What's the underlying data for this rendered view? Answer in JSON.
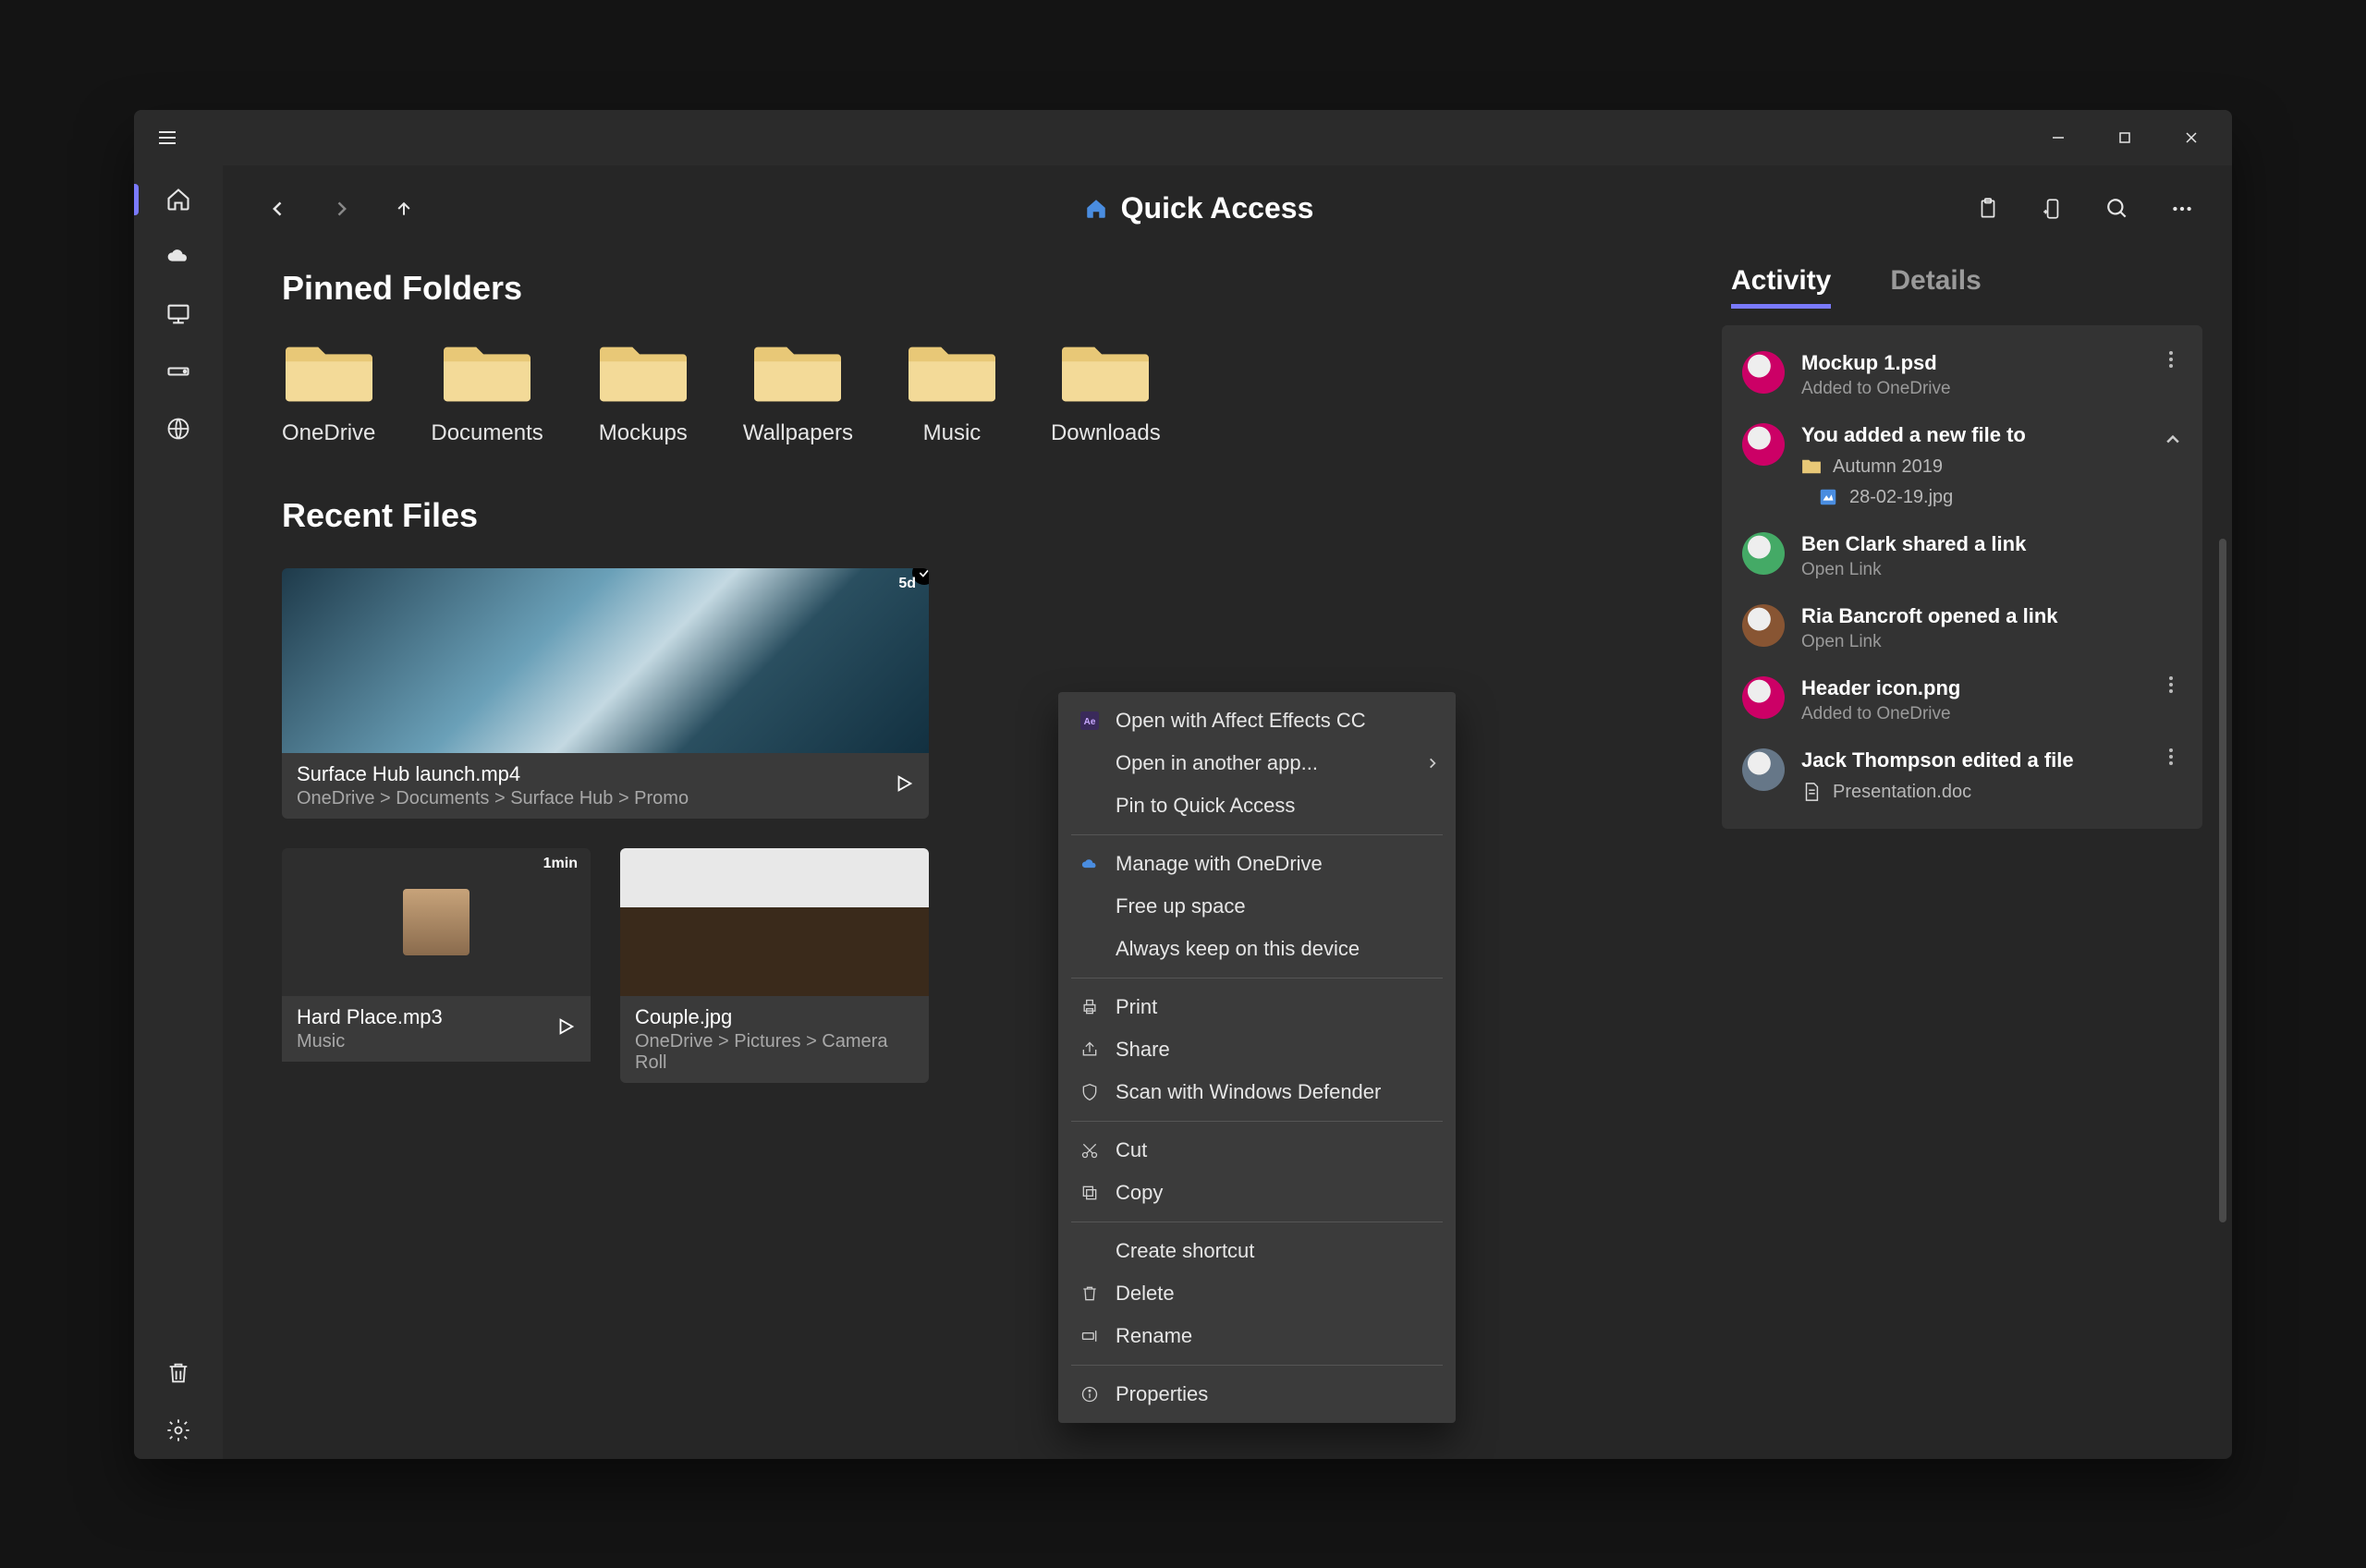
{
  "header": {
    "title": "Quick Access"
  },
  "sections": {
    "pinned_label": "Pinned Folders",
    "recent_label": "Recent Files"
  },
  "folders": [
    {
      "name": "OneDrive"
    },
    {
      "name": "Documents"
    },
    {
      "name": "Mockups"
    },
    {
      "name": "Wallpapers"
    },
    {
      "name": "Music"
    },
    {
      "name": "Downloads"
    }
  ],
  "recent": [
    {
      "name": "Surface Hub launch.mp4",
      "path": "OneDrive > Documents > Surface Hub > Promo",
      "badge": "5d"
    },
    {
      "name": "Hard Place.mp3",
      "path": "Music",
      "badge": "1min"
    },
    {
      "name": "Couple.jpg",
      "path": "OneDrive > Pictures > Camera Roll"
    }
  ],
  "tabs": {
    "activity": "Activity",
    "details": "Details"
  },
  "activity": [
    {
      "title": "Mockup 1.psd",
      "sub": "Added to OneDrive",
      "dots": true
    },
    {
      "title": "You added a new file to",
      "folder": "Autumn 2019",
      "file": "28-02-19.jpg",
      "chevron": true
    },
    {
      "title": "Ben Clark shared a link",
      "sub": "Open Link"
    },
    {
      "title": "Ria Bancroft opened a link",
      "sub": "Open Link"
    },
    {
      "title": "Header icon.png",
      "sub": "Added to OneDrive",
      "dots": true
    },
    {
      "title": "Jack Thompson edited a file",
      "doc": "Presentation.doc",
      "dots": true
    }
  ],
  "context_menu": [
    {
      "icon": "ae",
      "label": "Open with Affect Effects CC"
    },
    {
      "label": "Open in another app...",
      "arrow": true
    },
    {
      "label": "Pin to Quick Access"
    },
    {
      "sep": true
    },
    {
      "icon": "cloud",
      "label": "Manage with OneDrive"
    },
    {
      "label": "Free up space"
    },
    {
      "label": "Always keep on this device"
    },
    {
      "sep": true
    },
    {
      "icon": "print",
      "label": "Print"
    },
    {
      "icon": "share",
      "label": "Share"
    },
    {
      "icon": "shield",
      "label": "Scan with Windows Defender"
    },
    {
      "sep": true
    },
    {
      "icon": "cut",
      "label": "Cut"
    },
    {
      "icon": "copy",
      "label": "Copy"
    },
    {
      "sep": true
    },
    {
      "label": "Create shortcut"
    },
    {
      "icon": "trash",
      "label": "Delete"
    },
    {
      "icon": "rename",
      "label": "Rename"
    },
    {
      "sep": true
    },
    {
      "icon": "info",
      "label": "Properties"
    }
  ]
}
